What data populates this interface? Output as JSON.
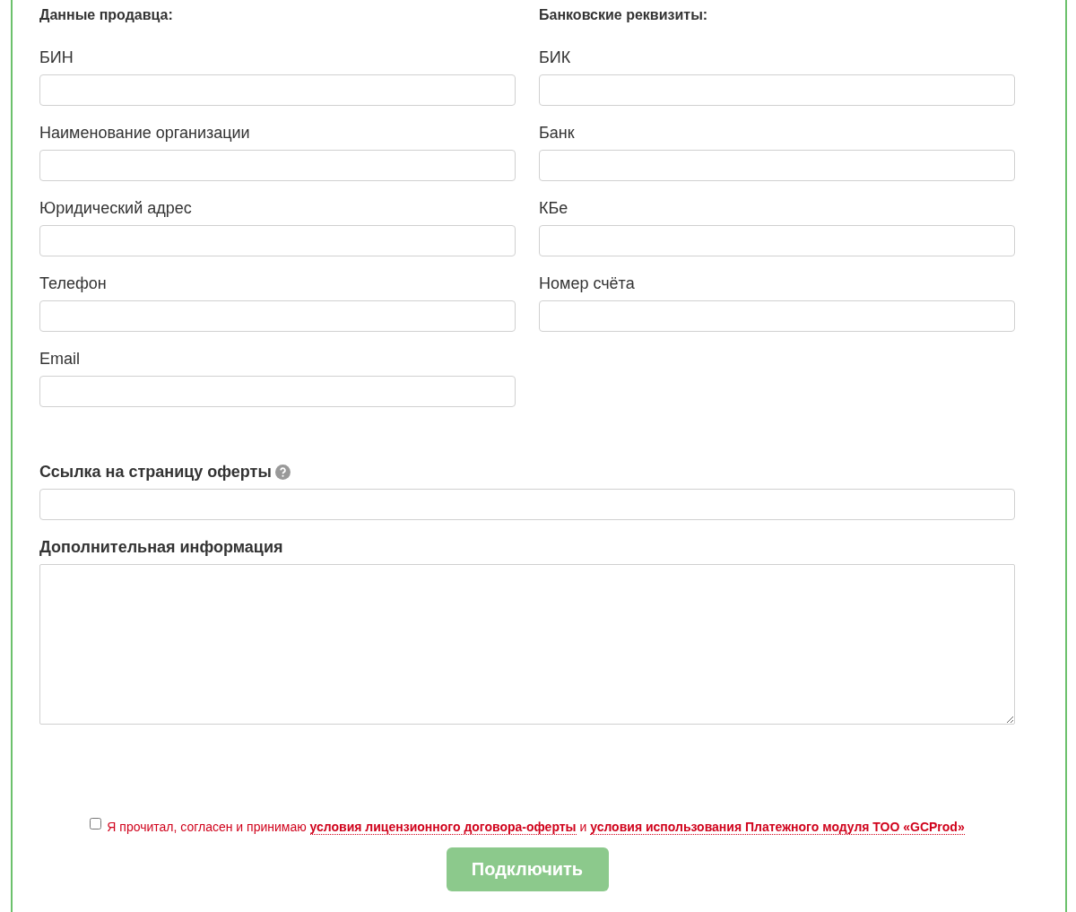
{
  "seller": {
    "heading": "Данные продавца:",
    "fields": [
      {
        "label": "БИН"
      },
      {
        "label": "Наименование организации"
      },
      {
        "label": "Юридический адрес"
      },
      {
        "label": "Телефон"
      },
      {
        "label": "Email"
      }
    ]
  },
  "bank": {
    "heading": "Банковские реквизиты:",
    "fields": [
      {
        "label": "БИК"
      },
      {
        "label": "Банк"
      },
      {
        "label": "КБе"
      },
      {
        "label": "Номер счёта"
      }
    ]
  },
  "offer_link": {
    "label": "Ссылка на страницу оферты"
  },
  "additional_info": {
    "label": "Дополнительная информация"
  },
  "agreement": {
    "checked": false,
    "text": "Я прочитал, согласен и принимаю",
    "links": [
      "условия лицензионного договора-оферты",
      "условия использования Платежного модуля ТОО «GCProd»"
    ],
    "conjunction": "и"
  },
  "submit": {
    "label": "Подключить",
    "disabled": true
  }
}
